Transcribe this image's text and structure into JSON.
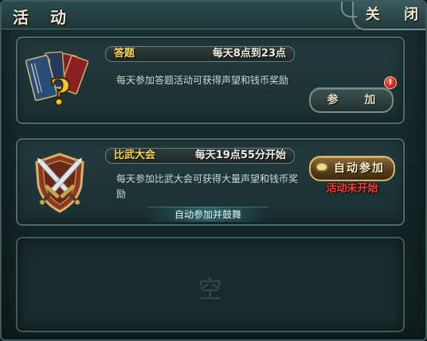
{
  "window": {
    "title": "活 动",
    "close_label": "关 闭"
  },
  "activities": [
    {
      "name": "答题",
      "schedule": "每天8点到23点",
      "description": "每天参加答题活动可获得声望和钱币奖励",
      "join_button": "参 加",
      "notification_badge": "!"
    },
    {
      "name": "比武大会",
      "schedule": "每天19点55分开始",
      "description": "每天参加比武大会可获得大量声望和钱币奖励",
      "auto_join_button": "自动参加",
      "status": "活动未开始",
      "auto_join_hint": "自动参加并鼓舞"
    }
  ],
  "empty_slot": {
    "label": "空"
  },
  "colors": {
    "activity_name": "#ffd84a",
    "status_warning": "#ff3a2e",
    "panel_bg": "#1a2f31",
    "border": "#4a6c6d"
  },
  "icons": {
    "quiz": "quiz-books-question-icon",
    "tournament": "crossed-swords-shield-icon"
  }
}
